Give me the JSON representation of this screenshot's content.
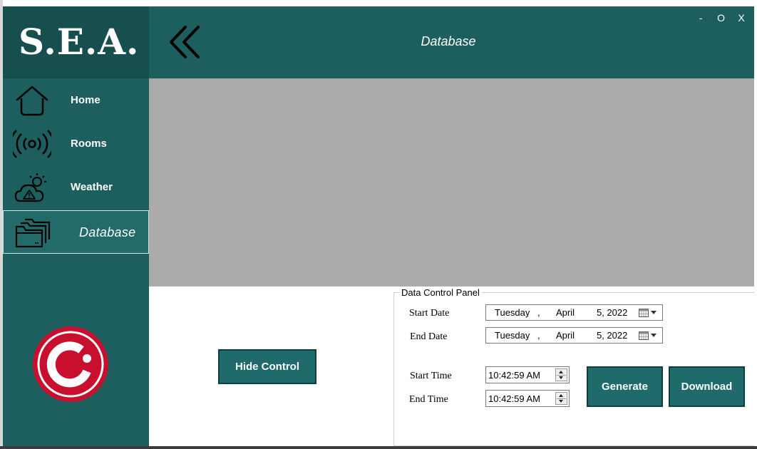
{
  "app": {
    "logo_text": "S.E.A.",
    "page_title": "Database",
    "window_controls": {
      "minimize": "-",
      "maximize": "O",
      "close": "X"
    }
  },
  "sidebar": {
    "items": [
      {
        "label": "Home",
        "icon": "home-icon"
      },
      {
        "label": "Rooms",
        "icon": "broadcast-icon"
      },
      {
        "label": "Weather",
        "icon": "weather-alert-icon"
      },
      {
        "label": "Database",
        "icon": "folders-icon",
        "active": true
      }
    ],
    "brand_logo_color": "#c8102e"
  },
  "controls": {
    "hide_label": "Hide Control",
    "panel_title": "Data Control Panel",
    "start_date_label": "Start Date",
    "end_date_label": "End Date",
    "start_time_label": "Start Time",
    "end_time_label": "End Time",
    "start_date": {
      "day": "Tuesday",
      "sep": ",",
      "month": "April",
      "date": "5, 2022"
    },
    "end_date": {
      "day": "Tuesday",
      "sep": ",",
      "month": "April",
      "date": "5, 2022"
    },
    "start_time": "10:42:59 AM",
    "end_time": "10:42:59 AM",
    "generate_label": "Generate",
    "download_label": "Download"
  },
  "colors": {
    "sidebar": "#1d5e5e",
    "logo_box": "#174f4f",
    "button": "#1f6b6b",
    "content_gray": "#ababab"
  }
}
